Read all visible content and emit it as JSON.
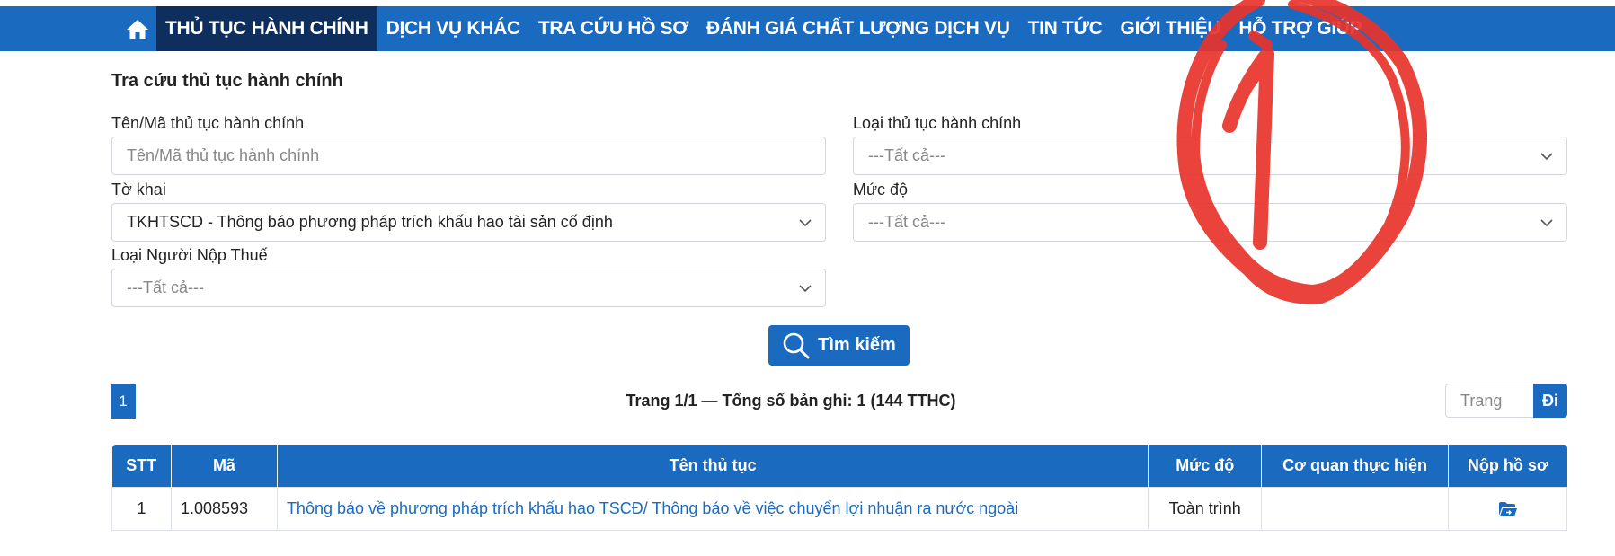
{
  "nav": {
    "items": [
      "THỦ TỤC HÀNH CHÍNH",
      "DỊCH VỤ KHÁC",
      "TRA CỨU HỒ SƠ",
      "ĐÁNH GIÁ CHẤT LƯỢNG DỊCH VỤ",
      "TIN TỨC",
      "GIỚI THIỆU",
      "HỖ TRỢ GIÚP"
    ],
    "active_index": 0,
    "home_icon": "home-icon"
  },
  "search": {
    "title": "Tra cứu thủ tục hành chính",
    "name_label": "Tên/Mã thủ tục hành chính",
    "name_placeholder": "Tên/Mã thủ tục hành chính",
    "type_label": "Loại thủ tục hành chính",
    "type_value": "---Tất cả---",
    "form_label": "Tờ khai",
    "form_value": "TKHTSCD - Thông báo phương pháp trích khấu hao tài sản cố định",
    "level_label": "Mức độ",
    "level_value": "---Tất cả---",
    "payer_label": "Loại Người Nộp Thuế",
    "payer_value": "---Tất cả---",
    "button_label": "Tìm kiếm"
  },
  "paging": {
    "current_page": "1",
    "info": "Trang 1/1 — Tổng số bản ghi: 1 (144 TTHC)",
    "goto_placeholder": "Trang",
    "goto_button": "Đi"
  },
  "table": {
    "headers": [
      "STT",
      "Mã",
      "Tên thủ tục",
      "Mức độ",
      "Cơ quan thực hiện",
      "Nộp hồ sơ"
    ],
    "rows": [
      {
        "stt": "1",
        "code": "1.008593",
        "name": "Thông báo về phương pháp trích khấu hao TSCĐ/ Thông báo về việc chuyển lợi nhuận ra nước ngoài",
        "level": "Toàn trình",
        "agency": "",
        "submit_icon": "folder-open-icon"
      }
    ]
  },
  "colors": {
    "primary": "#1a6bbf",
    "nav_active": "#0e2f5e",
    "annotation": "#e8342c"
  }
}
